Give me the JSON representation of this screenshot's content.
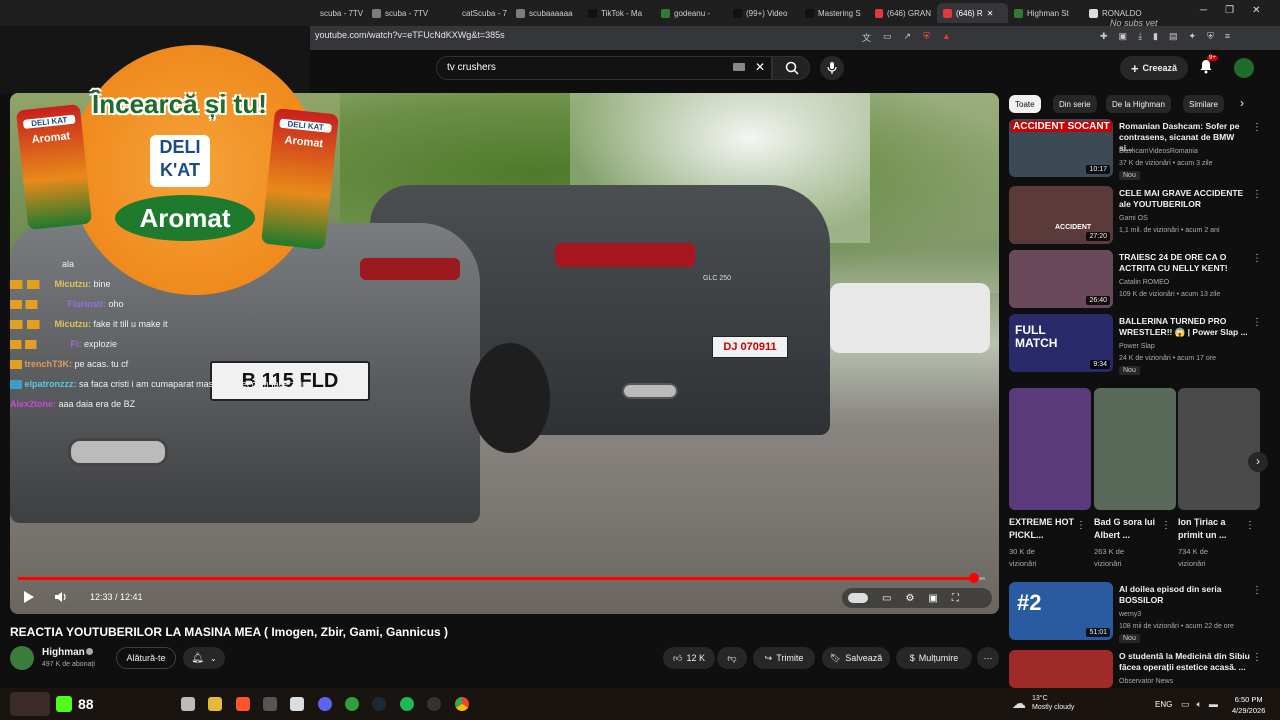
{
  "browser": {
    "tabs": [
      {
        "label": "scuba - 7TV",
        "color": "#7d7d7d"
      },
      {
        "label": "scuba - 7TV",
        "color": "#7d7d7d"
      },
      {
        "label": "catScuba - 7",
        "color": "#7d7d7d"
      },
      {
        "label": "scubaaaaaa",
        "color": "#7d7d7d"
      },
      {
        "label": "TikTok - Ma",
        "color": "#111111"
      },
      {
        "label": "godeanu - ",
        "color": "#2e7d32"
      },
      {
        "label": "(99+) Video",
        "color": "#111111"
      },
      {
        "label": "Mastering S",
        "color": "#111111"
      },
      {
        "label": "(646) GRAN",
        "color": "#e53935"
      },
      {
        "label": "(646) R",
        "color": "#e53935",
        "active": true
      },
      {
        "label": "Highman St",
        "color": "#2e7d32"
      },
      {
        "label": "RONALDO ",
        "color": "#dddddd"
      }
    ],
    "nosubs": "No subs yet",
    "url": "youtube.com/watch?v=eTFUcNdKXWg&t=385s"
  },
  "header": {
    "search_value": "tv crushers",
    "create_label": "Creează",
    "notif_count": "9+"
  },
  "chat": [
    {
      "user": "",
      "msg": "ala",
      "ucolor": "#9ad"
    },
    {
      "user": "Micutzu:",
      "msg": "bine",
      "ucolor": "#e3c35a"
    },
    {
      "user": "Florinsti:",
      "msg": "oho",
      "ucolor": "#9a6ce0"
    },
    {
      "user": "Micutzu:",
      "msg": "fake it till u make it",
      "ucolor": "#e3c35a"
    },
    {
      "user": "Fi:",
      "msg": "explozie",
      "ucolor": "#9a6ce0"
    },
    {
      "user": "trenchT3K:",
      "msg": "pe acas. tu cf",
      "ucolor": "#e39a5a"
    },
    {
      "user": "elpatronzzz:",
      "msg": "sa faca cristi i am cumaparat masina lu ket cum face zbir",
      "ucolor": "#5ac9e3"
    },
    {
      "user": "Alex2tone:",
      "msg": "aaa daia era de BZ",
      "ucolor": "#c94ad9"
    }
  ],
  "ad": {
    "headline": "Încearcă și tu!",
    "brand_top": "DELI",
    "brand_bottom": "K'AT",
    "product": "Aromat",
    "can_brand": "DELI KAT",
    "can_product": "Aromat"
  },
  "video": {
    "plate_left": "B 115 FLD",
    "plate_right": "DJ 070911",
    "car_badge": "GLC 250",
    "time": "12:33 / 12:41",
    "progress": 0.989,
    "title": "REACTIA YOUTUBERILOR LA MASINA MEA ( Imogen, Zbir, Gami, Gannicus )",
    "channel": "Highman",
    "subs": "497 K de abonați",
    "join_label": "Alătură-te",
    "likes": "12 K",
    "share_label": "Trimite",
    "save_label": "Salvează",
    "thanks_label": "Mulțumire"
  },
  "sidebar": {
    "chips": [
      {
        "label": "Toate",
        "selected": true
      },
      {
        "label": "Din serie"
      },
      {
        "label": "De la Highman"
      },
      {
        "label": "Similare"
      }
    ],
    "recs": [
      {
        "title": "Romanian Dashcam: Sofer pe contrasens, sicanat de BMW si...",
        "channel": "DashcamVideosRomania",
        "meta": "37 K de vizionări • acum 3 zile",
        "badge": "Nou",
        "duration": "10:17",
        "thumb_text": "ACCIDENT SOCANT",
        "color": "#3b4a55"
      },
      {
        "title": "CELE MAI GRAVE ACCIDENTE ale YOUTUBERILOR",
        "channel": "Gami OS",
        "meta": "1,1 mil. de vizionări • acum 2 ani",
        "badge": "",
        "duration": "27:20",
        "thumb_text": "ACCIDENT",
        "color": "#5a3a3a"
      },
      {
        "title": "TRAIESC 24 DE ORE CA O ACTRITA CU NELLY KENT!",
        "channel": "Catalin ROMEO",
        "meta": "109 K de vizionări • acum 13 zile",
        "badge": "",
        "duration": "26:40",
        "thumb_text": "",
        "color": "#6a4a5a"
      },
      {
        "title": "BALLERINA TURNED PRO WRESTLER!! 😱 | Power Slap ...",
        "channel": "Power Slap",
        "meta": "24 K de vizionări • acum 17 ore",
        "badge": "Nou",
        "duration": "9:34",
        "thumb_text": "FULL MATCH",
        "color": "#2a2a6a"
      }
    ],
    "shorts": [
      {
        "title": "EXTREME HOT PICKL...",
        "meta1": "30 K de",
        "meta2": "vizionări",
        "color": "#5a3a7a"
      },
      {
        "title": "Bad G sora lui Albert ...",
        "meta1": "263 K de",
        "meta2": "vizionări",
        "color": "#5a6a5a"
      },
      {
        "title": "Ion Țiriac a primit un ...",
        "meta1": "734 K de",
        "meta2": "vizionări",
        "color": "#4a4a4a"
      }
    ],
    "recs2": [
      {
        "title": "Al doilea episod din seria BOSSILOR",
        "channel": "wemy3",
        "meta": "108 mii de vizionări • acum 22 de ore",
        "badge": "Nou",
        "duration": "51:01",
        "thumb_text": "#2",
        "color": "#2a5aa0"
      },
      {
        "title": "O studentă la Medicină din Sibiu făcea operații estetice acasă. ...",
        "channel": "Observator News",
        "meta": "",
        "badge": "",
        "duration": "",
        "thumb_text": "",
        "color": "#a02a2a"
      }
    ]
  },
  "taskbar": {
    "count": "88",
    "weather_temp": "13°C",
    "weather_text": "Mostly cloudy",
    "lang": "ENG",
    "time": "6:50 PM",
    "date": "4/29/2026"
  }
}
